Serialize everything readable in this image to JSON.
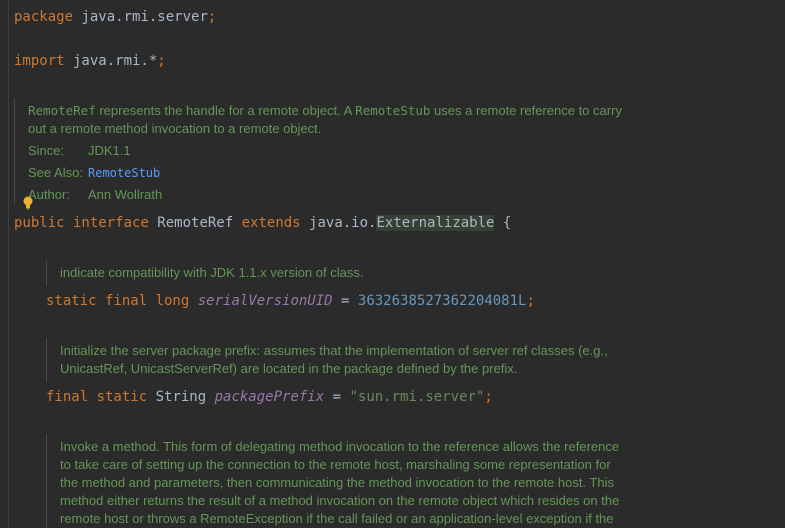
{
  "package_line": {
    "keyword": "package",
    "name": " java.rmi.server",
    "semicolon": ";"
  },
  "import_line": {
    "keyword": "import",
    "name": " java.rmi.*",
    "semicolon": ";"
  },
  "class_doc": {
    "line1_part1": "RemoteRef",
    "line1_part2": " represents the handle for a remote object. A ",
    "line1_part3": "RemoteStub",
    "line1_part4": " uses a remote reference to carry",
    "line2": "out a remote method invocation to a remote object.",
    "since_label": "Since:",
    "since_value": "JDK1.1",
    "see_also_label": "See Also:",
    "see_also_value": "RemoteStub",
    "author_label": "Author:",
    "author_value": "Ann Wollrath"
  },
  "interface_decl": {
    "kw_public": "public",
    "kw_interface": " interface",
    "name": " RemoteRef",
    "kw_extends": " extends",
    "type_prefix": " java.io.",
    "type_name": "Externalizable",
    "brace": " {"
  },
  "serial_doc": "indicate compatibility with JDK 1.1.x version of class.",
  "serial_decl": {
    "modifiers": "static final long",
    "name": "serialVersionUID",
    "eq": " = ",
    "value": "3632638527362204081L",
    "semicolon": ";"
  },
  "prefix_doc": {
    "line1": "Initialize the server package prefix: assumes that the implementation of server ref classes (e.g.,",
    "line2": "UnicastRef, UnicastServerRef) are located in the package defined by the prefix."
  },
  "prefix_decl": {
    "modifiers": "final static",
    "type": " String ",
    "name": "packagePrefix",
    "eq": " = ",
    "value": "\"sun.rmi.server\"",
    "semicolon": ";"
  },
  "invoke_doc": {
    "line1": "Invoke a method. This form of delegating method invocation to the reference allows the reference",
    "line2": "to take care of setting up the connection to the remote host, marshaling some representation for",
    "line3": "the method and parameters, then communicating the method invocation to the remote host. This",
    "line4": "method either returns the result of a method invocation on the remote object which resides on the",
    "line5": "remote host or throws a RemoteException if the call failed or an application-level exception if the"
  },
  "colors": {
    "background": "#2b2b2b",
    "keyword": "#cc7832",
    "doc": "#629755",
    "field": "#9876aa",
    "number": "#6897bb",
    "string": "#6a8759",
    "link": "#589df6"
  },
  "icons": {
    "intention": "lightbulb-icon"
  }
}
